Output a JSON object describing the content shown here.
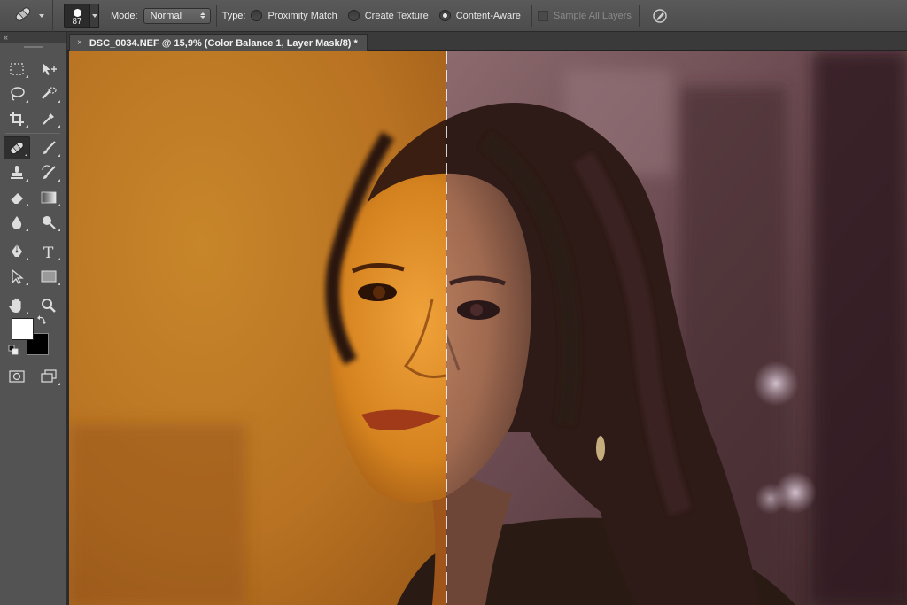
{
  "options_bar": {
    "brush_size": "87",
    "mode_label": "Mode:",
    "mode_value": "Normal",
    "type_label": "Type:",
    "type_options": [
      {
        "label": "Proximity Match",
        "selected": false
      },
      {
        "label": "Create Texture",
        "selected": false
      },
      {
        "label": "Content-Aware",
        "selected": true
      }
    ],
    "sample_all_layers_label": "Sample All Layers",
    "sample_all_layers_checked": false
  },
  "toolbar": {
    "collapse_label": "‹‹",
    "active_tool": "spot-healing-brush-icon",
    "foreground_color": "#ffffff",
    "background_color": "#000000"
  },
  "document": {
    "tab_title": "DSC_0034.NEF @ 15,9% (Color Balance 1, Layer Mask/8) *",
    "close_symbol": "×"
  },
  "colors": {
    "left_half_tone": "#c07a20",
    "right_half_tone": "#6e4a4a",
    "panel_gray": "#535353"
  }
}
